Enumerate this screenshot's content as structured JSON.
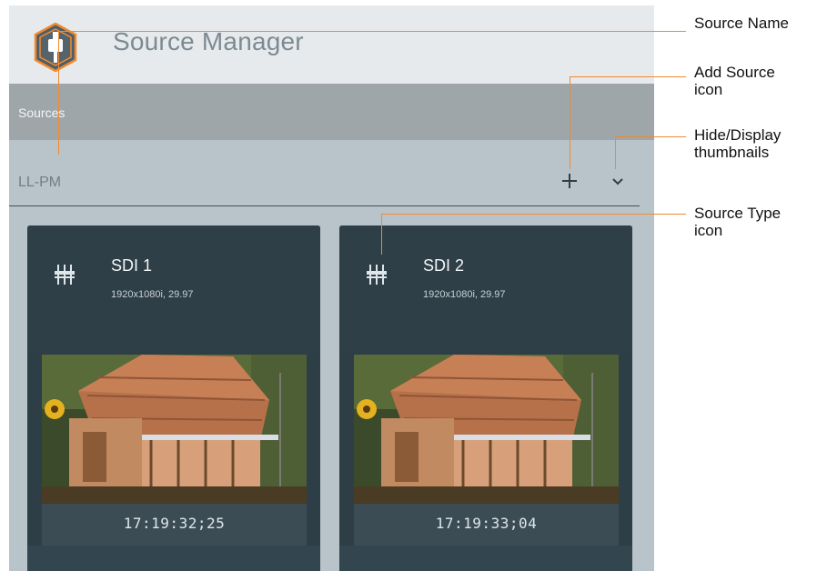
{
  "app": {
    "title": "Source Manager",
    "section_label": "Sources",
    "group_name": "LL-PM",
    "add_icon": "plus-icon",
    "toggle_icon": "chevron-down-icon",
    "logo_icon": "hexagon-plug-icon"
  },
  "cards": [
    {
      "name": "SDI 1",
      "format": "1920x1080i, 29.97",
      "timecode": "17:19:32;25",
      "type_icon": "sdi-connector-icon"
    },
    {
      "name": "SDI 2",
      "format": "1920x1080i, 29.97",
      "timecode": "17:19:33;04",
      "type_icon": "sdi-connector-icon"
    }
  ],
  "callouts": {
    "source_name": "Source Name",
    "add_source_1": "Add Source",
    "add_source_2": "icon",
    "hide_display_1": "Hide/Display",
    "hide_display_2": "thumbnails",
    "source_type_1": "Source Type",
    "source_type_2": "icon"
  },
  "colors": {
    "accent": "#f08a2f",
    "logo_fill": "#4f5e66",
    "card_bg": "#2d3e47",
    "panel_bg": "#b8c4c9"
  }
}
